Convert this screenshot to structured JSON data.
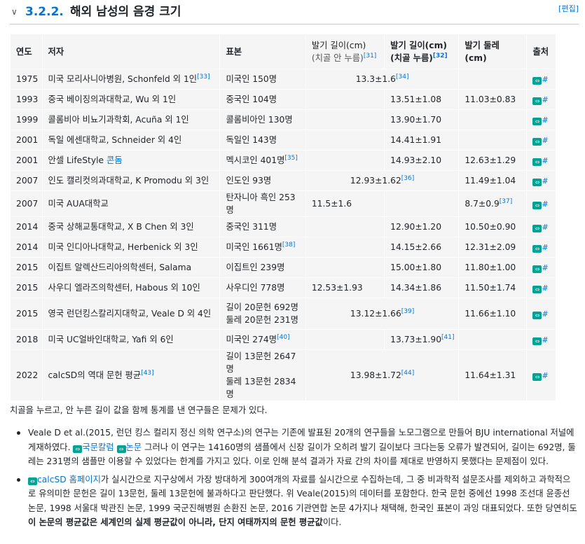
{
  "heading": {
    "chevron": "∨",
    "number": "3.2.2.",
    "title": "해외 남성의 음경 크기",
    "edit": "[편집]"
  },
  "table": {
    "headers": {
      "year": "연도",
      "author": "저자",
      "sample": "표본",
      "flaccid_line1": "발기 길이(cm)",
      "flaccid_line2": "(치골 안 누름)",
      "flaccid_ref": "[31]",
      "pressed_line1": "발기 길이(cm)",
      "pressed_line2": "(치골 누름)",
      "pressed_ref": "[32]",
      "girth": "발기 둘레(cm)",
      "source": "출처"
    },
    "rows": [
      {
        "year": "1975",
        "author": "미국 모리사니아병원, Schonfeld 외 1인",
        "author_ref": "[33]",
        "sample": "미국인 150명",
        "merged": "13.3±1.6",
        "merged_ref": "[34]",
        "girth": ""
      },
      {
        "year": "1993",
        "author": "중국 베이징의과대학교, Wu 외 1인",
        "sample": "중국인 104명",
        "unpressed": "",
        "pressed": "13.51±1.08",
        "girth": "11.03±0.83"
      },
      {
        "year": "1999",
        "author": "콜롬비아 비뇨기과학회, Acuña 외 1인",
        "sample": "콜롬비아인 130명",
        "unpressed": "",
        "pressed": "13.90±1.70",
        "girth": ""
      },
      {
        "year": "2001",
        "author": "독일 에센대학교, Schneider 외 4인",
        "sample": "독일인 143명",
        "unpressed": "",
        "pressed": "14.41±1.91",
        "girth": ""
      },
      {
        "year": "2001",
        "author": "안셀 LifeStyle",
        "author_link": "콘돔",
        "sample": "멕시코인 401명",
        "sample_ref": "[35]",
        "unpressed": "",
        "pressed": "14.93±2.10",
        "girth": "12.63±1.29"
      },
      {
        "year": "2007",
        "author": "인도 캘리컷의과대학교, K Promodu 외 3인",
        "sample": "인도인 93명",
        "merged": "12.93±1.62",
        "merged_ref": "[36]",
        "girth": "11.49±1.04"
      },
      {
        "year": "2007",
        "author": "미국 AUA대학교",
        "sample": "탄자니아 흑인 253명",
        "unpressed": "11.5±1.6",
        "pressed": "",
        "girth": "8.7±0.9",
        "girth_ref": "[37]"
      },
      {
        "year": "2014",
        "author": "중국 상해교통대학교, X B Chen 외 3인",
        "sample": "중국인 311명",
        "unpressed": "",
        "pressed": "12.90±1.20",
        "girth": "10.50±0.90"
      },
      {
        "year": "2014",
        "author": "미국 인디아나대학교, Herbenick 외 3인",
        "sample": "미국인 1661명",
        "sample_ref": "[38]",
        "unpressed": "",
        "pressed": "14.15±2.66",
        "girth": "12.31±2.09"
      },
      {
        "year": "2015",
        "author": "이집트 알렉산드리아의학센터, Salama",
        "sample": "이집트인 239명",
        "unpressed": "",
        "pressed": "15.00±1.80",
        "girth": "11.80±1.00"
      },
      {
        "year": "2015",
        "author": "사우디 엘라즈의학센터, Habous 외 10인",
        "sample": "사우디인 778명",
        "unpressed": "12.53±1.93",
        "pressed": "14.34±1.86",
        "girth": "11.50±1.74"
      },
      {
        "year": "2015",
        "author": "영국 런던킹스칼리지대학교, Veale D 외 4인",
        "sample": "길이 20문헌 692명",
        "sample2": "둘레 20문헌 231명",
        "merged": "13.12±1.66",
        "merged_ref": "[39]",
        "girth": "11.66±1.10"
      },
      {
        "year": "2018",
        "author": "미국 UC얼바인대학교, Yafi 외 6인",
        "sample": "미국인 274명",
        "sample_ref": "[40]",
        "unpressed": "",
        "pressed": "13.73±1.90",
        "pressed_ref": "[41]",
        "girth": ""
      },
      {
        "year": "2022",
        "author": "calcSD의 역대 문헌 평균",
        "author_ref": "[43]",
        "sample": "길이 13문헌 2647명",
        "sample2": "둘레 13문헌 2834명",
        "merged": "13.98±1.72",
        "merged_ref": "[44]",
        "girth": "11.64±1.31"
      }
    ],
    "source_icon": "link-icon",
    "source_hash": "#"
  },
  "paragraph": "치골을 누르고, 안 누른 길이 값을 함께 통계를 낸 연구들은 문제가 있다.",
  "notes": {
    "item1": {
      "text1": "Veale D et al.(2015, 런던 킹스 컬리지 정신 의학 연구소)의 연구는 기존에 발표된 20개의 연구들을 노모그램으로 만들어 BJU international 저널에 게재하였다. ",
      "link1": "국문칼럼",
      "link2": "논문",
      "text2": " 그러나 이 연구는 14160명의 샘플에서 신장 길이가 오히려 발기 길이보다 크다는둥 오류가 발견되어, 길이는 692명, 둘레는 231명의 샘플만 이용할 수 있었다는 한계를 가지고 있다. 이로 인해 분석 결과가 자료 간의 차이를 제대로 반영하지 못했다는 문제점이 있다."
    },
    "item2": {
      "link": "calcSD 홈페이지",
      "text1": "가 실시간으로 지구상에서 가장 방대하게 300여개의 자료를 실시간으로 수집하는데, 그 중 비과학적 설문조사를 제외하고 과학적으로 유의미한 문헌은 길이 13문헌, 둘레 13문헌에 불과하다고 판단했다. 위 Veale(2015)의 데이터를 포함한다. 한국 문헌 중에선 1998 조선대 윤종선 논문, 1998 서울대 박관진 논문, 1999 국군진해병원 손환진 논문, 2016 기관연합 논문 4가지나 채택해, 한국인 표본이 과잉 대표되었다. 또한 당연히도 ",
      "bold": "이 논문의 평균값은 세계인의 실제 평균값이 아니라, 단지 여태까지의 문헌 평균값",
      "text2": "이다."
    }
  }
}
